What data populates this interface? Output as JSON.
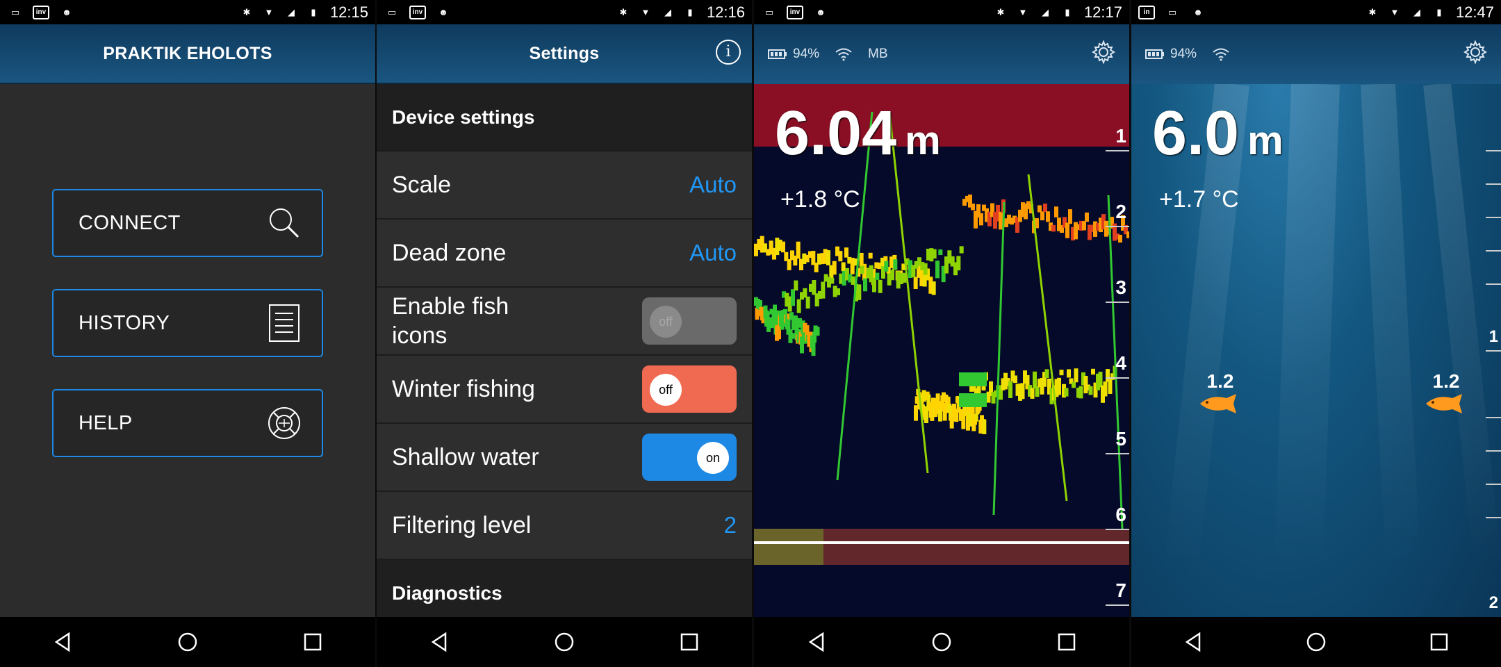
{
  "panels": [
    {
      "status_time": "12:15",
      "header_title": "PRAKTIK EHOLOTS",
      "menu": [
        {
          "label": "CONNECT",
          "icon": "search-icon"
        },
        {
          "label": "HISTORY",
          "icon": "document-icon"
        },
        {
          "label": "HELP",
          "icon": "lifebuoy-icon"
        }
      ]
    },
    {
      "status_time": "12:16",
      "header_title": "Settings",
      "info_icon": "i",
      "section_device": "Device settings",
      "rows": [
        {
          "label": "Scale",
          "value": "Auto"
        },
        {
          "label": "Dead zone",
          "value": "Auto"
        },
        {
          "label": "Enable fish icons",
          "toggle": "off",
          "state": "disabled"
        },
        {
          "label": "Winter fishing",
          "toggle": "off",
          "state": "off"
        },
        {
          "label": "Shallow water",
          "toggle": "on",
          "state": "on"
        },
        {
          "label": "Filtering level",
          "value": "2"
        }
      ],
      "section_diagnostics": "Diagnostics"
    },
    {
      "status_time": "12:17",
      "battery": "94%",
      "mode": "MB",
      "depth_value": "6.04",
      "depth_unit": "m",
      "temperature": "+1.8 °C",
      "scale_labels": [
        "1",
        "2",
        "3",
        "4",
        "5",
        "6",
        "7"
      ]
    },
    {
      "status_time": "12:47",
      "battery": "94%",
      "depth_value": "6.0",
      "depth_unit": "m",
      "temperature": "+1.7 °C",
      "fish": [
        {
          "depth": "1.2"
        },
        {
          "depth": "1.2"
        }
      ],
      "scale_labels": [
        "1",
        "2"
      ]
    }
  ],
  "nav": {
    "back": "back-icon",
    "home": "home-icon",
    "recents": "recents-icon"
  },
  "colors": {
    "accent": "#1e88e5",
    "header": "#1a5680",
    "toggle_off": "#f06a52",
    "value": "#2196f3",
    "deadzone": "#8b0f24",
    "fish": "#ff9a1e"
  }
}
